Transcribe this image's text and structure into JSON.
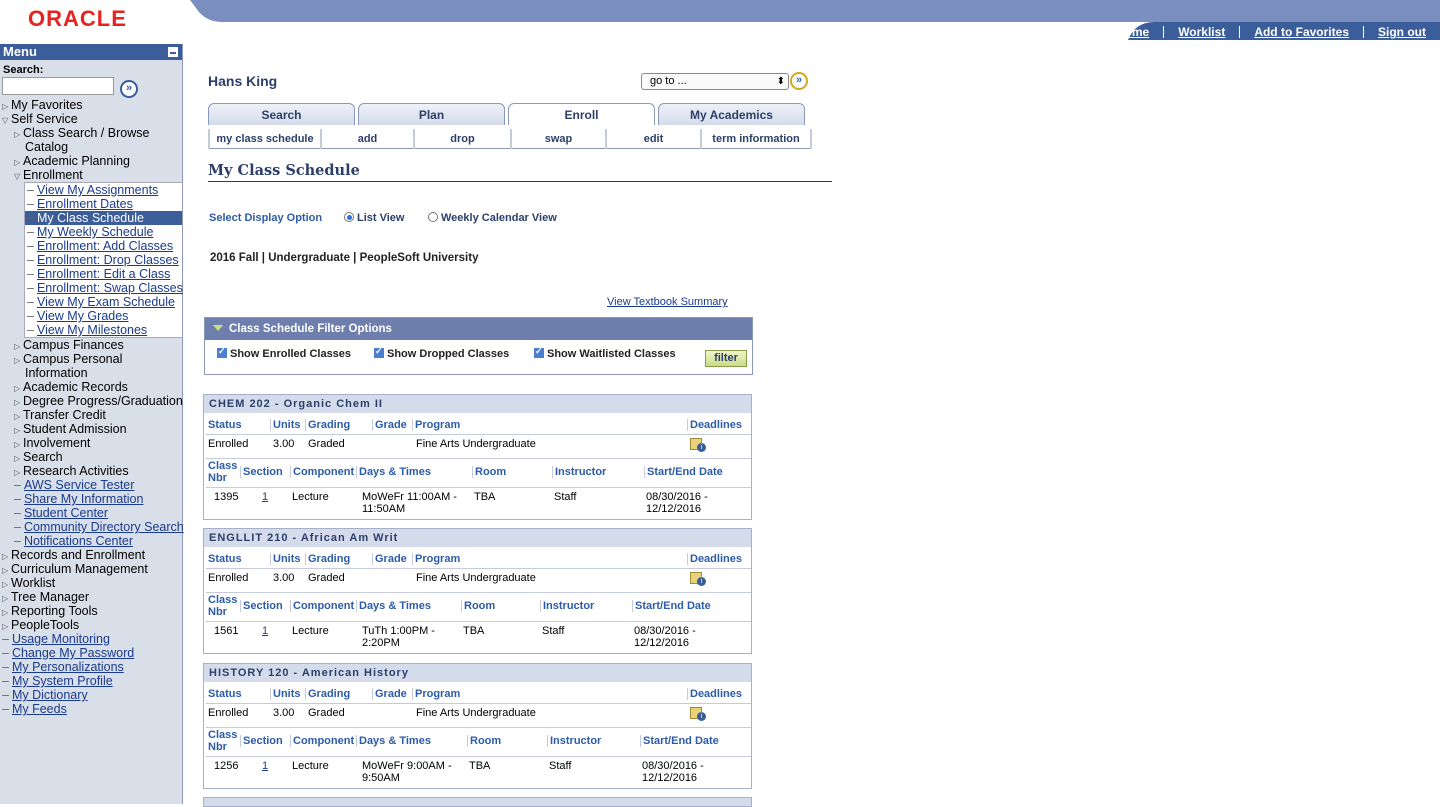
{
  "header": {
    "logo": "ORACLE",
    "links": [
      "Home",
      "Worklist",
      "Add to Favorites",
      "Sign out"
    ],
    "bar_color": "#7a8fc0"
  },
  "menu": {
    "title": "Menu",
    "search_label": "Search:",
    "items_top": [
      "My Favorites",
      "Self Service"
    ],
    "self_service": [
      "Class Search / Browse",
      "Catalog",
      "Academic Planning",
      "Enrollment"
    ],
    "enrollment": [
      "View My Assignments",
      "Enrollment Dates",
      "My Class Schedule",
      "My Weekly Schedule",
      "Enrollment: Add Classes",
      "Enrollment: Drop Classes",
      "Enrollment: Edit a Class",
      "Enrollment: Swap Classes",
      "View My Exam Schedule",
      "View My Grades",
      "View My Milestones"
    ],
    "after_enrollment": [
      "Campus Finances",
      "Campus Personal",
      "Information",
      "Academic Records",
      "Degree Progress/Graduation",
      "Transfer Credit",
      "Student Admission",
      "Involvement",
      "Search",
      "Research Activities"
    ],
    "ss_links": [
      "AWS Service Tester",
      "Share My Information",
      "Student Center",
      "Community Directory Search",
      "Notifications Center"
    ],
    "root_items": [
      "Records and Enrollment",
      "Curriculum Management",
      "Worklist",
      "Tree Manager",
      "Reporting Tools",
      "PeopleTools"
    ],
    "root_links": [
      "Usage Monitoring",
      "Change My Password",
      "My Personalizations",
      "My System Profile",
      "My Dictionary",
      "My Feeds"
    ]
  },
  "main": {
    "student_name": "Hans King",
    "goto_label": "go to ...",
    "tabs": [
      "Search",
      "Plan",
      "Enroll",
      "My Academics"
    ],
    "subtabs": [
      "my class schedule",
      "add",
      "drop",
      "swap",
      "edit",
      "term information"
    ],
    "page_title": "My Class Schedule",
    "display_option_label": "Select Display Option",
    "option_list": "List View",
    "option_calendar": "Weekly Calendar View",
    "term": "2016 Fall | Undergraduate | PeopleSoft University",
    "textbook_link": "View Textbook Summary",
    "filter": {
      "title": "Class Schedule Filter Options",
      "enrolled": "Show Enrolled Classes",
      "dropped": "Show Dropped Classes",
      "waitlisted": "Show Waitlisted Classes",
      "button": "filter"
    },
    "status_headers": [
      "Status",
      "Units",
      "Grading",
      "Grade",
      "Program",
      "Deadlines"
    ],
    "section_headers": [
      "Class",
      "Nbr",
      "Section",
      "Component",
      "Days & Times",
      "Room",
      "Instructor",
      "Start/End Date"
    ],
    "courses": [
      {
        "title": "CHEM 202 - Organic Chem II",
        "status": "Enrolled",
        "units": "3.00",
        "grading": "Graded",
        "program": "Fine Arts Undergraduate",
        "nbr": "1395",
        "section": "1",
        "component": "Lecture",
        "days1": "MoWeFr 11:00AM -",
        "days2": "11:50AM",
        "room": "TBA",
        "instructor": "Staff",
        "date1": "08/30/2016 -",
        "date2": "12/12/2016"
      },
      {
        "title": "ENGLLIT 210 - African Am Writ",
        "status": "Enrolled",
        "units": "3.00",
        "grading": "Graded",
        "program": "Fine Arts Undergraduate",
        "nbr": "1561",
        "section": "1",
        "component": "Lecture",
        "days1": "TuTh 1:00PM -",
        "days2": "2:20PM",
        "room": "TBA",
        "instructor": "Staff",
        "date1": "08/30/2016 -",
        "date2": "12/12/2016"
      },
      {
        "title": "HISTORY 120 - American History",
        "status": "Enrolled",
        "units": "3.00",
        "grading": "Graded",
        "program": "Fine Arts Undergraduate",
        "nbr": "1256",
        "section": "1",
        "component": "Lecture",
        "days1": "MoWeFr 9:00AM -",
        "days2": "9:50AM",
        "room": "TBA",
        "instructor": "Staff",
        "date1": "08/30/2016 -",
        "date2": "12/12/2016"
      }
    ]
  }
}
